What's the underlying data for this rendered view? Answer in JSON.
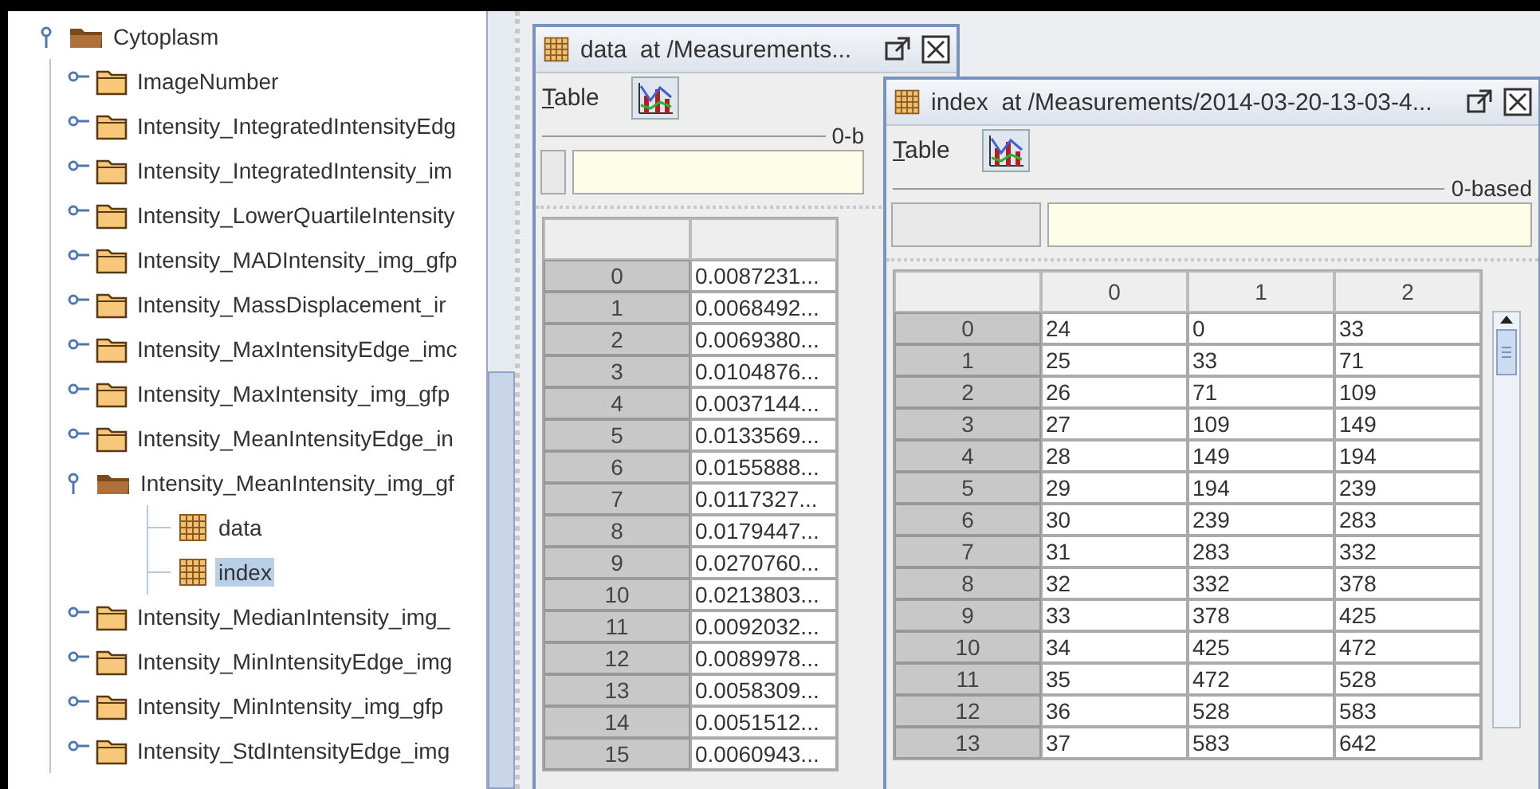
{
  "tree": {
    "label": "Cytoplasm",
    "kind": "group",
    "expanded": true,
    "selected": false,
    "children": [
      {
        "label": "ImageNumber",
        "kind": "group",
        "expanded": false,
        "selected": false
      },
      {
        "label": "Intensity_IntegratedIntensityEdg",
        "kind": "group",
        "expanded": false,
        "selected": false
      },
      {
        "label": "Intensity_IntegratedIntensity_im",
        "kind": "group",
        "expanded": false,
        "selected": false
      },
      {
        "label": "Intensity_LowerQuartileIntensity",
        "kind": "group",
        "expanded": false,
        "selected": false
      },
      {
        "label": "Intensity_MADIntensity_img_gfp",
        "kind": "group",
        "expanded": false,
        "selected": false
      },
      {
        "label": "Intensity_MassDisplacement_ir",
        "kind": "group",
        "expanded": false,
        "selected": false
      },
      {
        "label": "Intensity_MaxIntensityEdge_imc",
        "kind": "group",
        "expanded": false,
        "selected": false
      },
      {
        "label": "Intensity_MaxIntensity_img_gfp",
        "kind": "group",
        "expanded": false,
        "selected": false
      },
      {
        "label": "Intensity_MeanIntensityEdge_in",
        "kind": "group",
        "expanded": false,
        "selected": false
      },
      {
        "label": "Intensity_MeanIntensity_img_gf",
        "kind": "group",
        "expanded": true,
        "selected": false,
        "children": [
          {
            "label": "data",
            "kind": "dataset",
            "selected": false
          },
          {
            "label": "index",
            "kind": "dataset",
            "selected": true
          }
        ]
      },
      {
        "label": "Intensity_MedianIntensity_img_",
        "kind": "group",
        "expanded": false,
        "selected": false
      },
      {
        "label": "Intensity_MinIntensityEdge_img",
        "kind": "group",
        "expanded": false,
        "selected": false
      },
      {
        "label": "Intensity_MinIntensity_img_gfp",
        "kind": "group",
        "expanded": false,
        "selected": false
      },
      {
        "label": "Intensity_StdIntensityEdge_img",
        "kind": "group",
        "expanded": false,
        "selected": false
      }
    ]
  },
  "windows": [
    {
      "title": "data  at /Measurements...",
      "menu": "Table",
      "base_label": "0-b",
      "table": {
        "rows": [
          {
            "header": "0",
            "cells": [
              "0.0087231..."
            ]
          },
          {
            "header": "1",
            "cells": [
              "0.0068492..."
            ]
          },
          {
            "header": "2",
            "cells": [
              "0.0069380..."
            ]
          },
          {
            "header": "3",
            "cells": [
              "0.0104876..."
            ]
          },
          {
            "header": "4",
            "cells": [
              "0.0037144..."
            ]
          },
          {
            "header": "5",
            "cells": [
              "0.0133569..."
            ]
          },
          {
            "header": "6",
            "cells": [
              "0.0155888..."
            ]
          },
          {
            "header": "7",
            "cells": [
              "0.0117327..."
            ]
          },
          {
            "header": "8",
            "cells": [
              "0.0179447..."
            ]
          },
          {
            "header": "9",
            "cells": [
              "0.0270760..."
            ]
          },
          {
            "header": "10",
            "cells": [
              "0.0213803..."
            ]
          },
          {
            "header": "11",
            "cells": [
              "0.0092032..."
            ]
          },
          {
            "header": "12",
            "cells": [
              "0.0089978..."
            ]
          },
          {
            "header": "13",
            "cells": [
              "0.0058309..."
            ]
          },
          {
            "header": "14",
            "cells": [
              "0.0051512..."
            ]
          },
          {
            "header": "15",
            "cells": [
              "0.0060943..."
            ]
          }
        ]
      }
    },
    {
      "title": "index  at /Measurements/2014-03-20-13-03-4...",
      "menu": "Table",
      "base_label": "0-based",
      "table": {
        "columns": [
          "0",
          "1",
          "2"
        ],
        "rows": [
          {
            "header": "0",
            "cells": [
              "24",
              "0",
              "33"
            ]
          },
          {
            "header": "1",
            "cells": [
              "25",
              "33",
              "71"
            ]
          },
          {
            "header": "2",
            "cells": [
              "26",
              "71",
              "109"
            ]
          },
          {
            "header": "3",
            "cells": [
              "27",
              "109",
              "149"
            ]
          },
          {
            "header": "4",
            "cells": [
              "28",
              "149",
              "194"
            ]
          },
          {
            "header": "5",
            "cells": [
              "29",
              "194",
              "239"
            ]
          },
          {
            "header": "6",
            "cells": [
              "30",
              "239",
              "283"
            ]
          },
          {
            "header": "7",
            "cells": [
              "31",
              "283",
              "332"
            ]
          },
          {
            "header": "8",
            "cells": [
              "32",
              "332",
              "378"
            ]
          },
          {
            "header": "9",
            "cells": [
              "33",
              "378",
              "425"
            ]
          },
          {
            "header": "10",
            "cells": [
              "34",
              "425",
              "472"
            ]
          },
          {
            "header": "11",
            "cells": [
              "35",
              "472",
              "528"
            ]
          },
          {
            "header": "12",
            "cells": [
              "36",
              "528",
              "583"
            ]
          },
          {
            "header": "13",
            "cells": [
              "37",
              "583",
              "642"
            ]
          }
        ]
      }
    }
  ]
}
